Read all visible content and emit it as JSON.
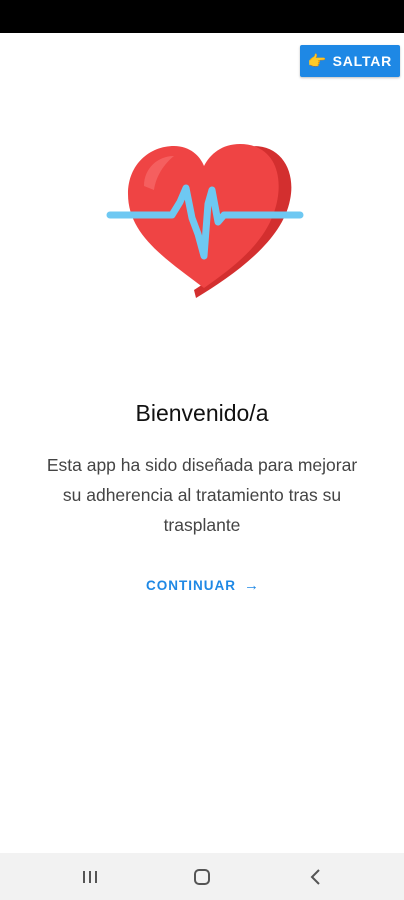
{
  "skip_button": {
    "icon": "pointing-hand-icon",
    "glyph": "👉",
    "label": "SALTAR"
  },
  "welcome": {
    "illustration": "heart-pulse-icon",
    "title": "Bienvenido/a",
    "text": "Esta app ha sido diseñada para mejorar su adherencia al tratamiento tras su trasplante"
  },
  "continue_button": {
    "label": "CONTINUAR",
    "arrow": "→"
  },
  "nav_bar": {
    "items": [
      "recent-apps-icon",
      "home-icon",
      "back-icon"
    ]
  },
  "colors": {
    "accent": "#1e88e5",
    "heart": "#e53935",
    "heart_light": "#f25c5c",
    "pulse": "#6ec8f2"
  }
}
